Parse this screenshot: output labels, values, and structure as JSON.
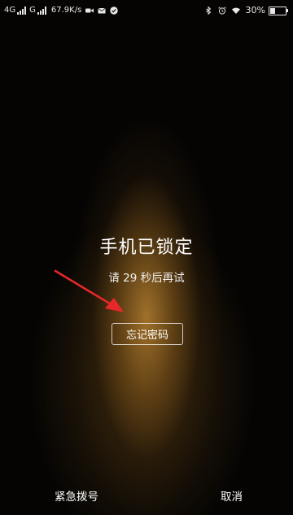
{
  "status_bar": {
    "sim1_label": "4G",
    "sim2_label": "G",
    "net_speed": "67.9K/s",
    "battery_percent": "30%",
    "battery_level": 0.3,
    "icons": [
      "signal-icon",
      "video-icon",
      "mail-icon",
      "check-icon",
      "bluetooth-icon",
      "alarm-icon",
      "wifi-icon",
      "battery-icon"
    ]
  },
  "lock_screen": {
    "title": "手机已锁定",
    "retry_text": "请 29 秒后再试",
    "forgot_password_label": "忘记密码"
  },
  "bottom": {
    "emergency_label": "紧急拨号",
    "cancel_label": "取消"
  },
  "colors": {
    "background": "#050403",
    "glow": "#aa782d",
    "annotation_arrow": "#e8272a",
    "text": "#ffffff"
  }
}
